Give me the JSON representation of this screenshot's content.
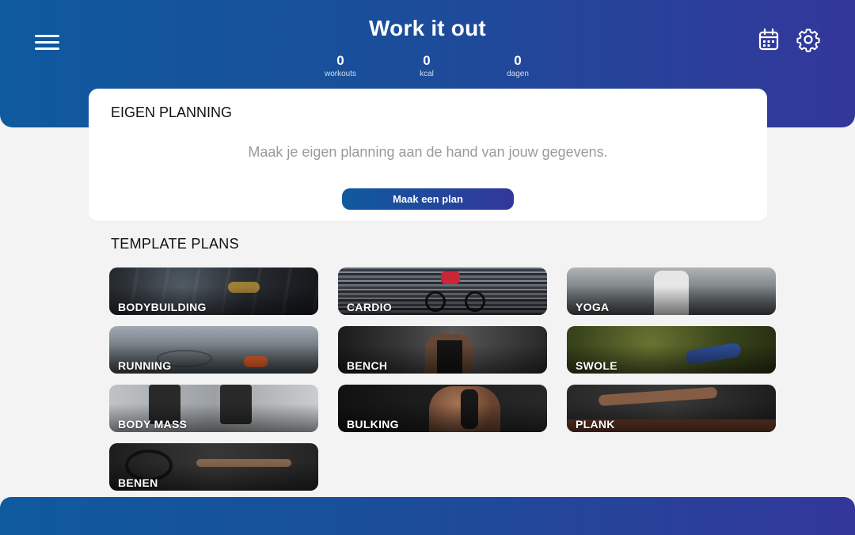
{
  "header": {
    "title": "Work it out",
    "stats": [
      {
        "value": "0",
        "label": "workouts"
      },
      {
        "value": "0",
        "label": "kcal"
      },
      {
        "value": "0",
        "label": "dagen"
      }
    ],
    "icons": {
      "menu": "hamburger-menu-icon",
      "calendar": "calendar-icon",
      "settings": "gear-icon"
    }
  },
  "planning": {
    "title": "EIGEN PLANNING",
    "description": "Maak je eigen planning aan de hand van jouw gegevens.",
    "button_label": "Maak een plan"
  },
  "templates": {
    "title": "TEMPLATE PLANS",
    "items": [
      {
        "label": "BODYBUILDING"
      },
      {
        "label": "CARDIO"
      },
      {
        "label": "YOGA"
      },
      {
        "label": "RUNNING"
      },
      {
        "label": "BENCH"
      },
      {
        "label": "SWOLE"
      },
      {
        "label": "BODY MASS"
      },
      {
        "label": "BULKING"
      },
      {
        "label": "PLANK"
      },
      {
        "label": "BENEN"
      }
    ]
  },
  "colors": {
    "gradient_start": "#0f5a9f",
    "gradient_end": "#33379a",
    "background": "#f3f3f3"
  }
}
